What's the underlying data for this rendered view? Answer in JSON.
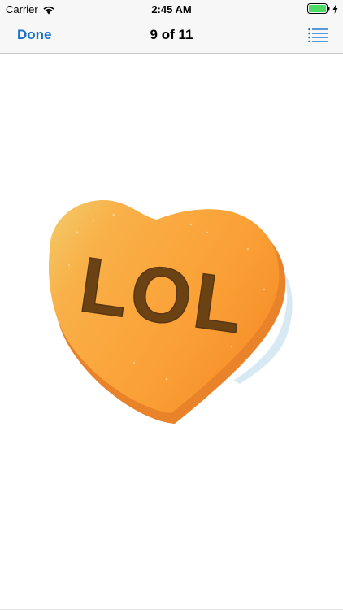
{
  "status_bar": {
    "carrier": "Carrier",
    "time": "2:45 AM",
    "battery_color": "#4cd964"
  },
  "nav": {
    "done_label": "Done",
    "title": "9 of 11",
    "list_icon": "list-icon",
    "accent_color": "#1a73c9"
  },
  "sticker": {
    "text": "LOL",
    "shape": "candy-heart",
    "fill_color": "#f9a33c",
    "text_color": "#6b4214"
  }
}
